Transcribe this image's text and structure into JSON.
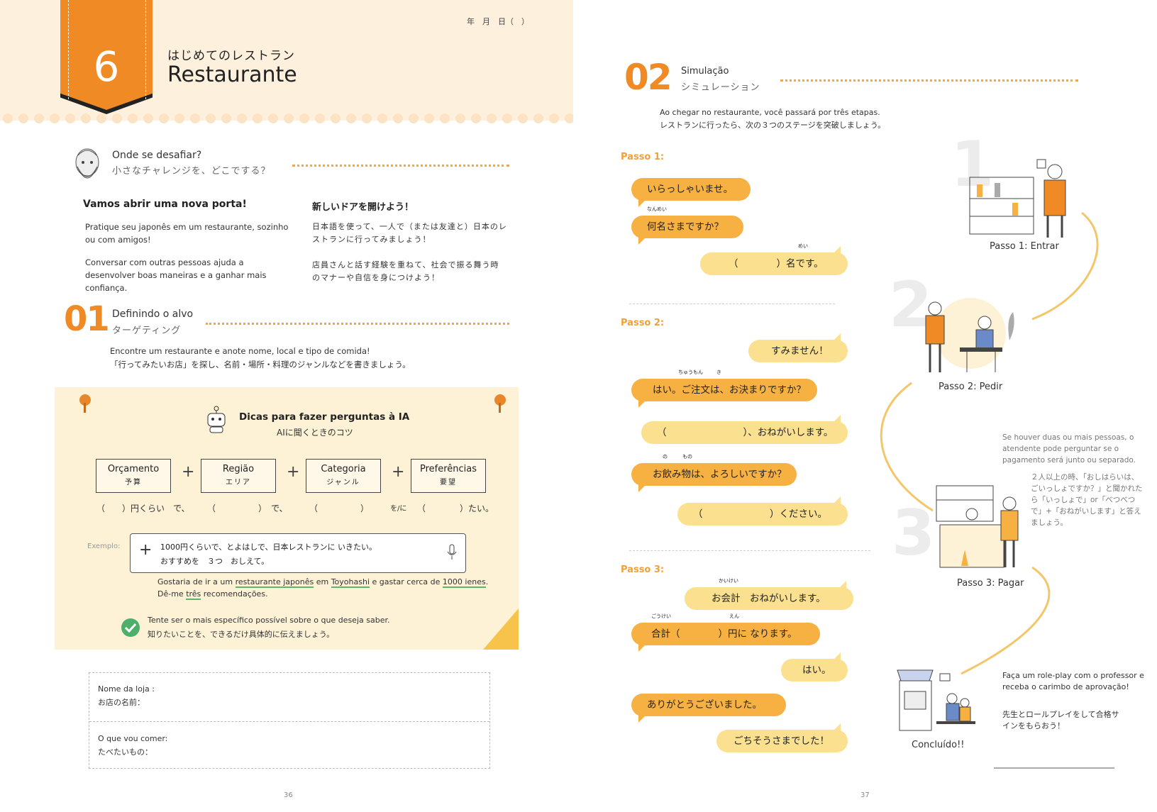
{
  "left": {
    "header": {
      "chapter_number": "6",
      "chapter_jp": "はじめてのレストラン",
      "chapter_title": "Restaurante",
      "date_line": "年　月　日（　）"
    },
    "challenge": {
      "title_pt": "Onde se desafiar?",
      "title_jp": "小さなチャレンジを、どこでする？",
      "heading_pt": "Vamos abrir uma nova porta!",
      "heading_jp": "新しいドアを開けよう！",
      "p1_pt": "Pratique seu japonês em um restaurante, sozinho ou com amigos!",
      "p2_pt": "Conversar com outras pessoas ajuda a desenvolver boas maneiras e a ganhar mais confiança.",
      "p1_jp": "日本語を使って、一人で（または友達と）日本のレストランに行ってみましょう！",
      "p2_jp": "店員さんと話す経験を重ねて、社会で振る舞う時のマナーや自信を身につけよう！"
    },
    "section01": {
      "number": "01",
      "title_pt": "Definindo o alvo",
      "title_jp": "ターゲティング",
      "text_pt": "Encontre um restaurante e anote nome, local e tipo de comida!",
      "text_jp": "「行ってみたいお店」を探し、名前・場所・料理のジャンルなどを書きましょう。"
    },
    "tips": {
      "title_pt": "Dicas para fazer perguntas à IA",
      "title_jp": "AIに聞くときのコツ",
      "boxes": [
        {
          "pt": "Orçamento",
          "jp": "予算"
        },
        {
          "pt": "Região",
          "jp": "エリア"
        },
        {
          "pt": "Categoria",
          "jp": "ジャンル"
        },
        {
          "pt": "Preferências",
          "jp": "要望"
        }
      ],
      "plus": "+",
      "fill_1": "（　　）円くらい　で、",
      "fill_2": "（　　　　　）　で、",
      "fill_3": "（　　　　　）",
      "fill_4": "を/に",
      "fill_5": "（　　　　）たい。",
      "example_label": "Exemplo:",
      "prompt_line1": "1000円くらいで、とよはしで、日本レストランに いきたい。",
      "prompt_line2": "おすすめを　３つ　おしえて。",
      "translation_a": "Gostaria de ir a um ",
      "translation_u1": "restaurante japonês",
      "translation_b": " em ",
      "translation_u2": "Toyohashi",
      "translation_c": " e gastar cerca de ",
      "translation_u3": "1000 ienes",
      "translation_d": ".",
      "translation2_a": "Dê-me ",
      "translation2_u": "três",
      "translation2_b": " recomendações.",
      "check_pt": "Tente ser o mais específico possível sobre o que deseja saber.",
      "check_jp": "知りたいことを、できるだけ具体的に伝えましょう。"
    },
    "form": {
      "shop_pt": "Nome da loja :",
      "shop_jp": "お店の名前：",
      "food_pt": "O que vou comer:",
      "food_jp": "たべたいもの："
    },
    "page_number": "36"
  },
  "right": {
    "section02": {
      "number": "02",
      "title_pt": "Simulação",
      "title_jp": "シミュレーション",
      "intro_pt": "Ao chegar no restaurante, você passará por três etapas.",
      "intro_jp": "レストランに行ったら、次の３つのステージを突破しましょう。"
    },
    "steps": [
      {
        "label": "Passo 1:",
        "caption": "Passo 1: Entrar",
        "ghost": "1"
      },
      {
        "label": "Passo 2:",
        "caption": "Passo 2: Pedir",
        "ghost": "2"
      },
      {
        "label": "Passo 3:",
        "caption": "Passo 3: Pagar",
        "ghost": "3"
      }
    ],
    "dialog1": [
      "いらっしゃいませ。",
      "何名さまですか？",
      "（　　　　）名です。"
    ],
    "dialog2": [
      "すみません！",
      "はい。ご注文は、お決まりですか？",
      "（　　　　　　　　）、おねがいします。",
      "お飲み物は、よろしいですか？",
      "（　　　　　　　）ください。"
    ],
    "dialog3": [
      "お会計　おねがいします。",
      "合計（　　　　）円に なります。",
      "はい。",
      "ありがとうございました。",
      "ごちそうさまでした！"
    ],
    "furigana": {
      "nanmei": "なんめい",
      "mei": "めい",
      "chuumon": "ちゅうもん",
      "ki": "き",
      "nomi": "の",
      "mono": "もの",
      "kaikei": "かいけい",
      "goukei": "ごうけい",
      "en": "えん"
    },
    "note_pt": "Se houver duas ou mais pessoas, o atendente pode perguntar se o pagamento será junto ou separado.",
    "note_jp": "２人以上の時、「おしはらいは、ごいっしょですか？」と聞かれたら「いっしょで」or「べつべつで」+「おねがいします」と答えましょう。",
    "final_caption": "Concluído!!",
    "final_pt": "Faça um role-play com o professor e receba o carimbo de aprovação!",
    "final_jp": "先生とロールプレイをして合格サインをもらおう！",
    "page_number": "37"
  },
  "colors": {
    "orange": "#f08a24",
    "bubble_dark": "#f6b142",
    "bubble_light": "#fbe08f",
    "band": "#fdf0dc"
  }
}
